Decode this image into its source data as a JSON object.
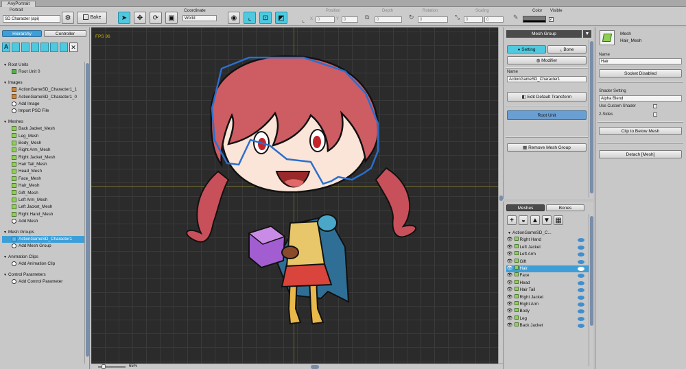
{
  "window": {
    "tab": "AnyPortrait"
  },
  "toolbar": {
    "portrait_label": "Portrait",
    "portrait_value": "SD Character (api)",
    "bake": "Bake",
    "coordinate_label": "Coordinate",
    "coordinate_value": "World",
    "position": "Position",
    "depth": "Depth",
    "rotation": "Rotation",
    "scaling": "Scaling",
    "color": "Color",
    "visible": "Visible",
    "x_label": "X",
    "y_label": "Y",
    "pos_x": "0",
    "pos_y": "0",
    "depth_value": "0",
    "rotation_value": "0",
    "scale_x": "0",
    "scale_y": "0"
  },
  "left": {
    "tab_hierarchy": "Hierarchy",
    "tab_controller": "Controller",
    "root_units": "Root Units",
    "root_unit_0": "Root Unit 0",
    "images": "Images",
    "image_items": [
      "ActionGameSD_Character1_1",
      "ActionGameSD_Character1_0"
    ],
    "add_image": "Add Image",
    "import_psd": "Import PSD File",
    "meshes": "Meshes",
    "mesh_items": [
      "Back Jacket_Mesh",
      "Leg_Mesh",
      "Body_Mesh",
      "Right Arm_Mesh",
      "Right Jacket_Mesh",
      "Hair Tail_Mesh",
      "Head_Mesh",
      "Face_Mesh",
      "Hair_Mesh",
      "Gift_Mesh",
      "Left Arm_Mesh",
      "Left Jacket_Mesh",
      "Right Hand_Mesh"
    ],
    "add_mesh": "Add Mesh",
    "mesh_groups": "Mesh Groups",
    "mesh_group_item": "ActionGameSD_Character1",
    "add_mesh_group": "Add Mesh Group",
    "animation_clips": "Animation Clips",
    "add_animation_clip": "Add Animation Clip",
    "control_parameters": "Control Parameters",
    "add_control_parameter": "Add Control Parameter"
  },
  "canvas": {
    "fps": "FPS 96",
    "zoom": "65%"
  },
  "meshgroup": {
    "header": "Mesh Group",
    "setting": "Setting",
    "bone": "Bone",
    "modifier": "Modifier",
    "name_label": "Name",
    "name_value": "ActionGameSD_Character1",
    "edit_default": "Edit Default Transform",
    "root_unit": "Root Unit",
    "remove": "Remove Mesh Group"
  },
  "meshlist": {
    "tab_meshes": "Meshes",
    "tab_bones": "Bones",
    "group": "ActionGameSD_C...",
    "items": [
      "Right Hand",
      "Left Jacket",
      "Left Arm",
      "Gift",
      "Hair",
      "Face",
      "Head",
      "Hair Tail",
      "Right Jacket",
      "Right Arm",
      "Body",
      "Leg",
      "Back Jacket"
    ]
  },
  "inspector": {
    "type": "Mesh",
    "mesh_name": "Hair_Mesh",
    "name_label": "Name",
    "name_value": "Hair",
    "socket": "Socket Disabled",
    "shader_setting": "Shader Setting",
    "shader_value": "Alpha Blend",
    "use_custom_shader": "Use Custom Shader",
    "two_sides": "2-Sides",
    "clip": "Clip to Below Mesh",
    "detach": "Detach [Mesh]"
  },
  "colors": {
    "accent": "#3e9fd8",
    "active_tool": "#4ec9e0",
    "canvas_bg": "#2b2b2b",
    "grid": "#3a3a3a",
    "outline": "#2a6fcf"
  }
}
